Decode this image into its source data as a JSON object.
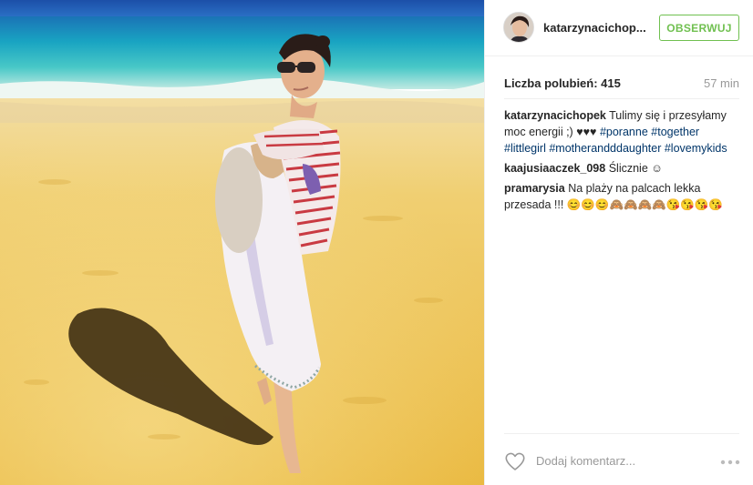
{
  "post": {
    "username": "katarzynacichop...",
    "follow_label": "OBSERWUJ",
    "likes_text": "Liczba polubień: 415",
    "time_text": "57 min"
  },
  "caption": {
    "user": "katarzynacichopek",
    "text": "Tulimy się i przesyłamy moc energii ;) ",
    "hearts": "♥♥♥",
    "tags": [
      "#poranne",
      "#together",
      "#littlegirl",
      "#motherandddaughter",
      "#lovemykids"
    ]
  },
  "comments": [
    {
      "user": "kaajusiaaczek_098",
      "text": "Ślicznie ☺"
    },
    {
      "user": "pramarysia",
      "text": "Na plaży na palcach lekka przesada !!! 😊😊😊🙈🙈🙈🙈😘😘😘😘"
    }
  ],
  "footer": {
    "comment_placeholder": "Dodaj komentarz..."
  },
  "icons": {
    "heart": "heart-outline-icon",
    "more": "more-options-icon"
  },
  "colors": {
    "follow_green": "#70c050",
    "hashtag": "#003569",
    "muted": "#999999"
  }
}
